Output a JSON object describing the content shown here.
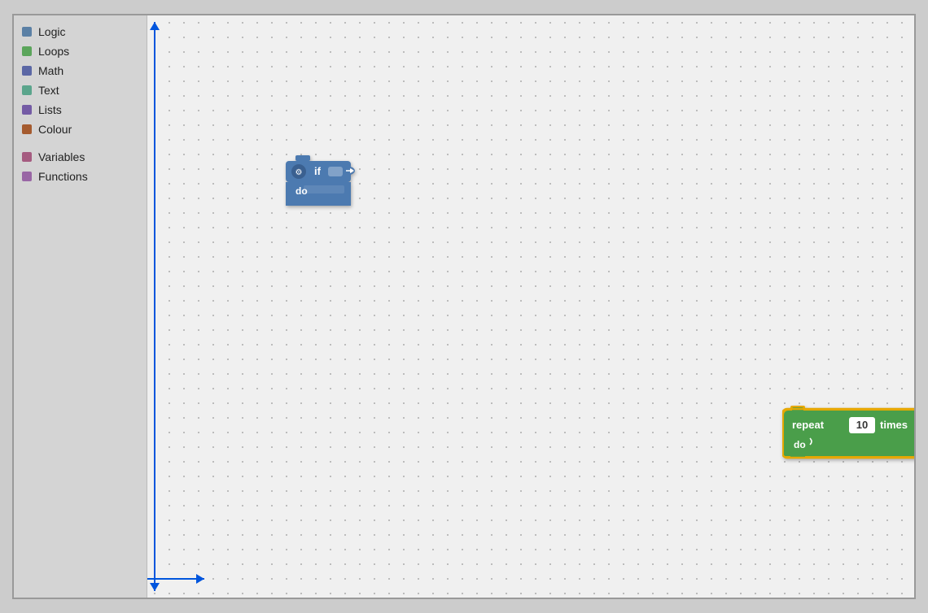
{
  "sidebar": {
    "items": [
      {
        "id": "logic",
        "label": "Logic",
        "color": "#5b80a5"
      },
      {
        "id": "loops",
        "label": "Loops",
        "color": "#5ba55b"
      },
      {
        "id": "math",
        "label": "Math",
        "color": "#5b67a5"
      },
      {
        "id": "text",
        "label": "Text",
        "color": "#5ba58c"
      },
      {
        "id": "lists",
        "label": "Lists",
        "color": "#745ba5"
      },
      {
        "id": "colour",
        "label": "Colour",
        "color": "#a55b2f"
      }
    ],
    "items2": [
      {
        "id": "variables",
        "label": "Variables",
        "color": "#a55b80"
      },
      {
        "id": "functions",
        "label": "Functions",
        "color": "#9966a5"
      }
    ]
  },
  "blocks": {
    "if_block": {
      "if_label": "if",
      "do_label": "do"
    },
    "repeat_block": {
      "repeat_label": "repeat",
      "times_label": "times",
      "do_label": "do",
      "count": "10"
    }
  }
}
